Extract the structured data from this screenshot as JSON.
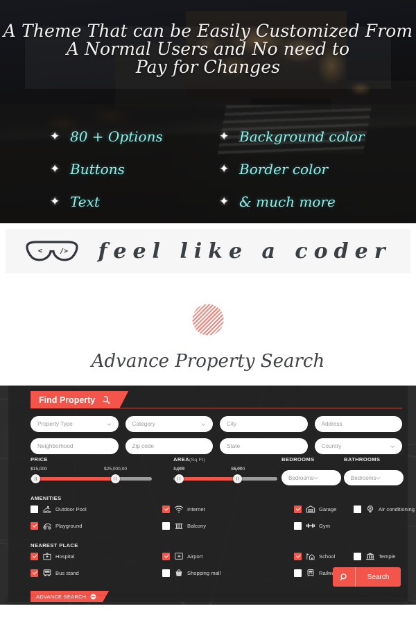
{
  "hero": {
    "title_lines": [
      "A Theme That can be Easily Customized From",
      "A Normal Users and No need to",
      "Pay for Changes"
    ],
    "features": [
      {
        "label": "80 + Options",
        "icon": "diamond-bullet-icon"
      },
      {
        "label": "Background color",
        "icon": "diamond-bullet-icon"
      },
      {
        "label": "Buttons",
        "icon": "diamond-bullet-icon"
      },
      {
        "label": "Border color",
        "icon": "diamond-bullet-icon"
      },
      {
        "label": "Text",
        "icon": "diamond-bullet-icon"
      },
      {
        "label": "& much more",
        "icon": "diamond-bullet-icon"
      }
    ],
    "feature_color": "#8ff0e8",
    "bullet_glyph": "✦"
  },
  "coder_band": {
    "icon": "nerd-glasses-icon",
    "lens_left_text": "<",
    "lens_right_text": "/>",
    "text": "feel like a coder"
  },
  "advance_search_heading": {
    "divider_icon": "diamond-lines-divider-icon",
    "divider_color": "#f4857a",
    "title": "Advance Property Search"
  },
  "search_panel": {
    "tab": {
      "label": "Find Property",
      "icon": "search-icon"
    },
    "accent_color": "#f4554a",
    "fields": [
      {
        "name": "property-type",
        "value": "Property Type",
        "type": "select"
      },
      {
        "name": "category",
        "value": "Category",
        "type": "select"
      },
      {
        "name": "city",
        "value": "City",
        "type": "text"
      },
      {
        "name": "address",
        "value": "Address",
        "type": "text"
      },
      {
        "name": "neighborhood",
        "value": "Neighborhood",
        "type": "text"
      },
      {
        "name": "zip-code",
        "value": "Zip code",
        "type": "text"
      },
      {
        "name": "state",
        "value": "State",
        "type": "text"
      },
      {
        "name": "country",
        "value": "Country",
        "type": "select"
      }
    ],
    "price": {
      "label": "PRICE",
      "min_label": "$15,000",
      "max_label": "$25,000,00",
      "fill_start_pct": 4,
      "fill_end_pct": 70
    },
    "area": {
      "label": "AREA",
      "unit": "(Sq Ft)",
      "min_label": "1,000",
      "min_unit": "Sq Ft",
      "max_label": "15,000",
      "max_unit": "Sq Ft",
      "fill_start_pct": 5,
      "fill_end_pct": 62
    },
    "bedrooms": {
      "label": "BEDROOMS",
      "value": "Bedrooms"
    },
    "bathrooms": {
      "label": "BATHROOMS",
      "value": "Bedrooms"
    },
    "amenities": {
      "title": "AMENITIES",
      "items": [
        {
          "label": "Outdoor Pool",
          "checked": false,
          "icon": "pool-icon"
        },
        {
          "label": "Internet",
          "checked": true,
          "icon": "wifi-icon"
        },
        {
          "label": "Playground",
          "checked": true,
          "icon": "playground-icon"
        },
        {
          "label": "Garage",
          "checked": true,
          "icon": "garage-icon"
        },
        {
          "label": "Air conditioning",
          "checked": false,
          "icon": "air-conditioning-icon"
        },
        {
          "label": "Balcony",
          "checked": false,
          "icon": "balcony-icon"
        },
        {
          "label": "Gym",
          "checked": false,
          "icon": "dumbbell-icon"
        }
      ]
    },
    "nearest_place": {
      "title": "NEAREST PLACE",
      "items": [
        {
          "label": "Hospital",
          "checked": true,
          "icon": "hospital-icon"
        },
        {
          "label": "Airport",
          "checked": true,
          "icon": "airport-icon"
        },
        {
          "label": "Bus stand",
          "checked": true,
          "icon": "bus-icon"
        },
        {
          "label": "School",
          "checked": true,
          "icon": "school-icon"
        },
        {
          "label": "Temple",
          "checked": false,
          "icon": "temple-icon"
        },
        {
          "label": "Shopping mall",
          "checked": false,
          "icon": "shopping-bag-icon"
        },
        {
          "label": "Railway station",
          "checked": false,
          "icon": "train-icon"
        }
      ]
    },
    "search_button": {
      "label": "Search",
      "icon": "search-icon"
    },
    "advance_search_tag": {
      "label": "ADVANCE SEARCH",
      "icon": "minus-circle-icon"
    }
  }
}
